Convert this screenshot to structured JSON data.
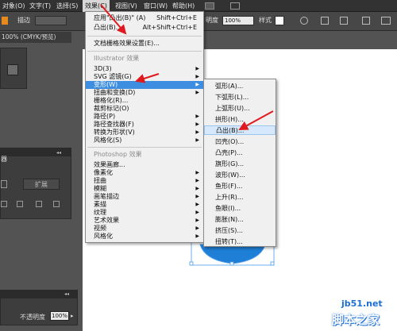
{
  "menubar": {
    "items": [
      "对象(O)",
      "文字(T)",
      "选择(S)",
      "效果(C)",
      "视图(V)",
      "窗口(W)",
      "帮助(H)"
    ]
  },
  "controlbar": {
    "stroke_label": "描边",
    "opacity_label": "明度",
    "opacity_value": "100%",
    "style_label": "样式"
  },
  "document_tab": "100% (CMYK/预览)",
  "left_panel": {
    "title": "器",
    "expand_button": "扩展",
    "opacity_label": "不透明度",
    "opacity_value": "100%"
  },
  "effect_menu": {
    "items": [
      {
        "label": "应用\"凸出(B)\" (A)",
        "shortcut": "Shift+Ctrl+E"
      },
      {
        "label": "凸出(B)...",
        "shortcut": "Alt+Shift+Ctrl+E"
      },
      {
        "label": "文档栅格效果设置(E)..."
      }
    ],
    "illustrator_section": "Illustrator 效果",
    "illustrator_items": [
      "3D(3)",
      "SVG 滤镜(G)",
      "变形(W)",
      "扭曲和变换(D)",
      "栅格化(R)...",
      "裁剪标记(O)",
      "路径(P)",
      "路径查找器(F)",
      "转换为形状(V)",
      "风格化(S)"
    ],
    "photoshop_section": "Photoshop 效果",
    "photoshop_items": [
      "效果画廊...",
      "像素化",
      "扭曲",
      "模糊",
      "画笔描边",
      "素描",
      "纹理",
      "艺术效果",
      "视频",
      "风格化"
    ]
  },
  "warp_submenu": {
    "items": [
      "弧形(A)...",
      "下弧形(L)...",
      "上弧形(U)...",
      "拱形(H)...",
      "凸出(B)...",
      "凹壳(O)...",
      "凸壳(P)...",
      "旗形(G)...",
      "波形(W)...",
      "鱼形(F)...",
      "上升(R)...",
      "鱼眼(I)...",
      "膨胀(N)...",
      "挤压(S)...",
      "扭转(T)..."
    ]
  },
  "watermark": {
    "url": "jb51.net",
    "brand": "脚本之家"
  },
  "colors": {
    "highlight": "#3d8ee0",
    "red_arrow": "#e0191e",
    "shape_blue": "#1f7fd6"
  }
}
